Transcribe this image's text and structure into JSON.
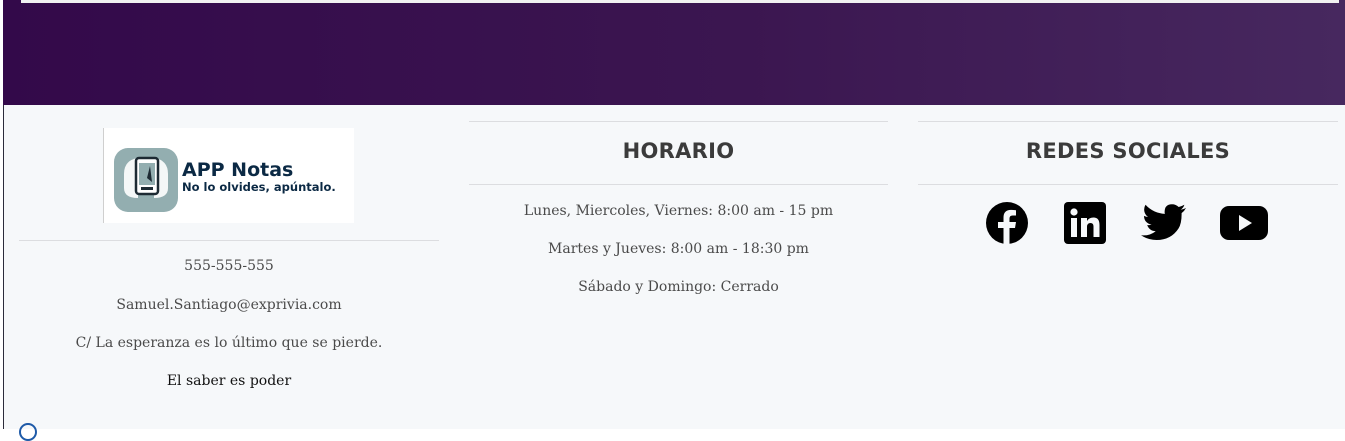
{
  "brand": {
    "title": "APP Notas",
    "tagline": "No lo olvides, apúntalo."
  },
  "contact": {
    "phone": "555-555-555",
    "email": "Samuel.Santiago@exprivia.com",
    "address": "C/ La esperanza es lo último que se pierde.",
    "motto": "El saber es poder"
  },
  "schedule": {
    "heading": "HORARIO",
    "lines": [
      "Lunes, Miercoles, Viernes: 8:00 am - 15 pm",
      "Martes y Jueves: 8:00 am - 18:30 pm",
      "Sábado y Domingo: Cerrado"
    ]
  },
  "social": {
    "heading": "REDES SOCIALES",
    "icons": [
      "facebook-icon",
      "linkedin-icon",
      "twitter-icon",
      "youtube-icon"
    ]
  },
  "colors": {
    "hero_start": "#33094a",
    "hero_end": "#47285f",
    "footer_bg": "#f6f8fa",
    "brand_text": "#0b2944",
    "logo_accent": "#93aeb0"
  }
}
